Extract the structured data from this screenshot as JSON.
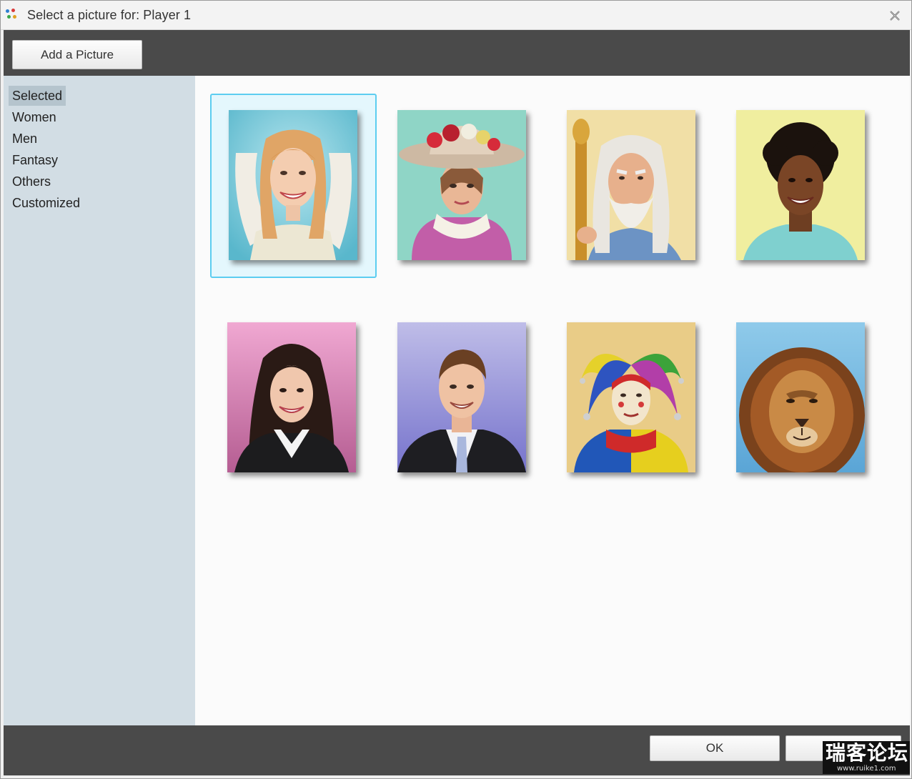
{
  "window": {
    "title": "Select a picture for: Player 1"
  },
  "toolbar": {
    "add_label": "Add a Picture"
  },
  "sidebar": {
    "items": [
      {
        "label": "Selected",
        "selected": true
      },
      {
        "label": "Women",
        "selected": false
      },
      {
        "label": "Men",
        "selected": false
      },
      {
        "label": "Fantasy",
        "selected": false
      },
      {
        "label": "Others",
        "selected": false
      },
      {
        "label": "Customized",
        "selected": false
      }
    ]
  },
  "pictures": [
    {
      "subject": "angel-woman",
      "selected": true
    },
    {
      "subject": "woman-flower-hat",
      "selected": false
    },
    {
      "subject": "wizard-old-man",
      "selected": false
    },
    {
      "subject": "curly-hair-woman",
      "selected": false
    },
    {
      "subject": "business-woman",
      "selected": false
    },
    {
      "subject": "business-man",
      "selected": false
    },
    {
      "subject": "jester",
      "selected": false
    },
    {
      "subject": "lion",
      "selected": false
    }
  ],
  "footer": {
    "ok_label": "OK"
  },
  "watermark": {
    "text": "瑞客论坛",
    "url": "www.ruike1.com"
  },
  "colors": {
    "toolbar_bg": "#4a4a4a",
    "sidebar_bg": "#d2dde4",
    "selection_border": "#5ccdf0",
    "selection_fill": "#e4f7fd"
  }
}
